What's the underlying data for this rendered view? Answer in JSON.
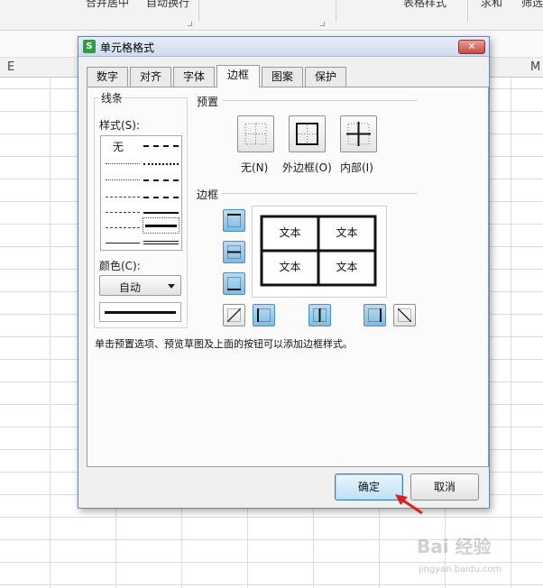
{
  "spreadsheet": {
    "ribbon_items": [
      "合并居中",
      "自动换行",
      "表格样式",
      "求和",
      "筛选"
    ],
    "column_headers": [
      "E",
      "M"
    ]
  },
  "dialog": {
    "title": "单元格格式",
    "app_icon_letter": "S",
    "close_symbol": "✕",
    "tabs": [
      {
        "label": "数字",
        "active": false
      },
      {
        "label": "对齐",
        "active": false
      },
      {
        "label": "字体",
        "active": false
      },
      {
        "label": "边框",
        "active": true
      },
      {
        "label": "图案",
        "active": false
      },
      {
        "label": "保护",
        "active": false
      }
    ],
    "line_section": {
      "group_label": "线条",
      "style_label": "样式(S):",
      "none_label": "无",
      "color_label": "颜色(C):",
      "color_value": "自动"
    },
    "preset_section": {
      "label": "预置",
      "buttons": [
        {
          "label": "无(N)",
          "icon": "preset-none-icon"
        },
        {
          "label": "外边框(O)",
          "icon": "preset-outline-icon"
        },
        {
          "label": "内部(I)",
          "icon": "preset-inside-icon"
        }
      ]
    },
    "border_section": {
      "label": "边框",
      "preview_cells": [
        "文本",
        "文本",
        "文本",
        "文本"
      ]
    },
    "hint": "单击预置选项、预览草图及上面的按钮可以添加边框样式。",
    "ok_label": "确定",
    "cancel_label": "取消"
  },
  "watermark": {
    "text": "Bai 经验",
    "sub": "jingyan.baidu.com"
  },
  "colors": {
    "accent": "#7dbde6",
    "close": "#c94b3e",
    "arrow": "#e02020"
  }
}
